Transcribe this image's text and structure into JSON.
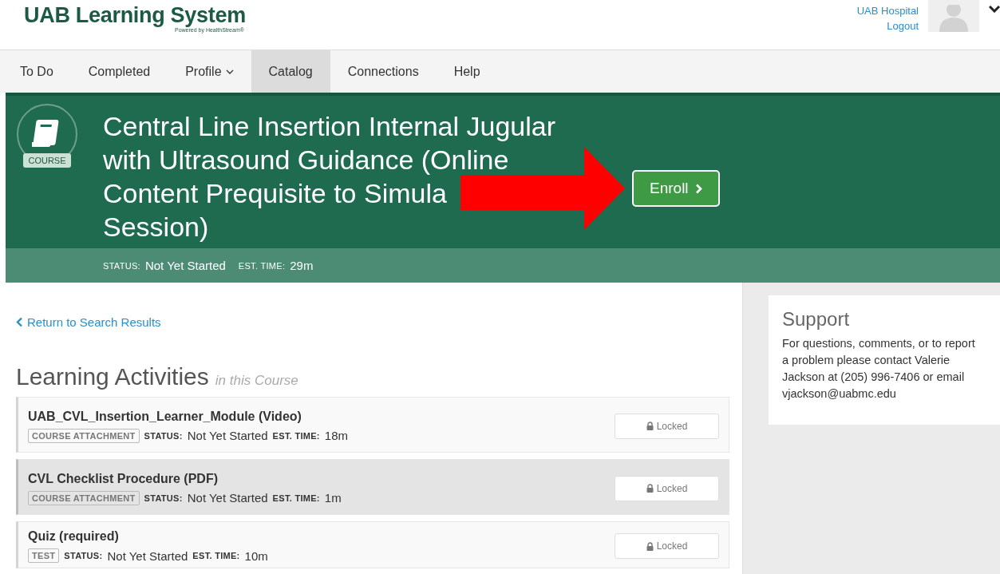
{
  "header": {
    "logo": "UAB Learning System",
    "logo_tagline": "Powered by HealthStream®",
    "user_links": [
      "UAB Hospital",
      "Logout"
    ]
  },
  "nav": [
    {
      "label": "To Do",
      "selected": false,
      "dropdown": false
    },
    {
      "label": "Completed",
      "selected": false,
      "dropdown": false
    },
    {
      "label": "Profile",
      "selected": false,
      "dropdown": true
    },
    {
      "label": "Catalog",
      "selected": true,
      "dropdown": false
    },
    {
      "label": "Connections",
      "selected": false,
      "dropdown": false
    },
    {
      "label": "Help",
      "selected": false,
      "dropdown": false
    }
  ],
  "course": {
    "badge": "COURSE",
    "title_lines": [
      "Central Line Insertion Internal Jugular",
      "with Ultrasound Guidance (Online",
      "Content Prequisite to Simula",
      "Session)"
    ],
    "enroll_button": "Enroll",
    "status_label": "STATUS:",
    "status": "Not Yet Started",
    "time_label": "EST. TIME:",
    "time": "29m"
  },
  "back_link": "Return to Search Results",
  "activities_heading": {
    "title": "Learning Activities",
    "subtitle": "in this Course"
  },
  "activities": [
    {
      "title": "UAB_CVL_Insertion_Learner_Module (Video)",
      "type": "COURSE ATTACHMENT",
      "status_label": "STATUS:",
      "status": "Not Yet Started",
      "time_label": "EST. TIME:",
      "time": "18m",
      "button": "Locked",
      "highlighted": false
    },
    {
      "title": "CVL Checklist Procedure (PDF)",
      "type": "COURSE ATTACHMENT",
      "status_label": "STATUS:",
      "status": "Not Yet Started",
      "time_label": "EST. TIME:",
      "time": "1m",
      "button": "Locked",
      "highlighted": true
    },
    {
      "title": "Quiz (required)",
      "type": "TEST",
      "status_label": "STATUS:",
      "status": "Not Yet Started",
      "time_label": "EST. TIME:",
      "time": "10m",
      "button": "Locked",
      "highlighted": false
    }
  ],
  "support": {
    "title": "Support",
    "text": "For questions, comments, or to report a problem please contact Valerie Jackson at (205) 996-7406 or email vjackson@uabmc.edu"
  }
}
